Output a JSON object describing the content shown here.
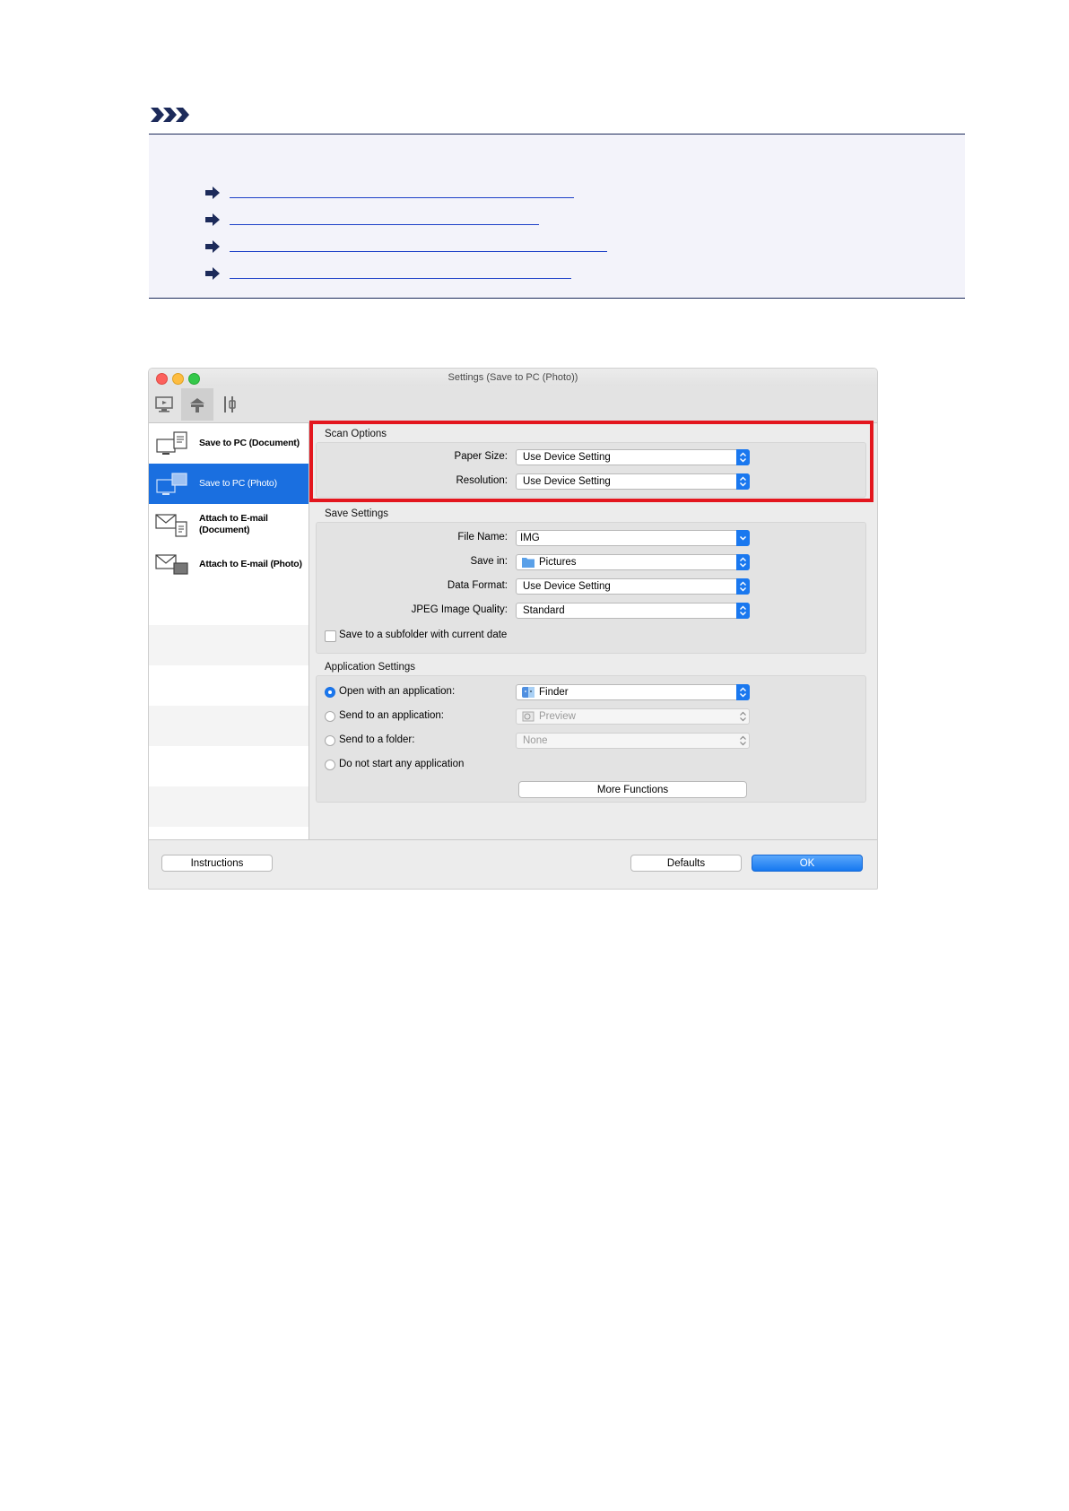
{
  "note": {
    "icon": "note-arrows-icon",
    "links": [
      {
        "id": "link-1",
        "text": ""
      },
      {
        "id": "link-2",
        "text": ""
      },
      {
        "id": "link-3",
        "text": ""
      },
      {
        "id": "link-4",
        "text": ""
      }
    ],
    "link_color": "#1c3fc7"
  },
  "window": {
    "title": "Settings (Save to PC (Photo))",
    "toolbar": [
      "scan-from-computer-icon",
      "scan-from-operation-panel-icon",
      "general-settings-icon"
    ],
    "sidebar": [
      {
        "label": "Save to PC (Document)",
        "selected": false
      },
      {
        "label": "Save to PC (Photo)",
        "selected": true
      },
      {
        "label": "Attach to E-mail (Document)",
        "selected": false
      },
      {
        "label": "Attach to E-mail (Photo)",
        "selected": false
      }
    ],
    "scan_options": {
      "title": "Scan Options",
      "paper_size_label": "Paper Size:",
      "paper_size_value": "Use Device Setting",
      "resolution_label": "Resolution:",
      "resolution_value": "Use Device Setting"
    },
    "save_settings": {
      "title": "Save Settings",
      "file_name_label": "File Name:",
      "file_name_value": "IMG",
      "save_in_label": "Save in:",
      "save_in_value": "Pictures",
      "data_format_label": "Data Format:",
      "data_format_value": "Use Device Setting",
      "jpeg_label": "JPEG Image Quality:",
      "jpeg_value": "Standard",
      "subfolder_label": "Save to a subfolder with current date"
    },
    "app_settings": {
      "title": "Application Settings",
      "open_app_label": "Open with an application:",
      "open_app_value": "Finder",
      "send_app_label": "Send to an application:",
      "send_app_value": "Preview",
      "send_folder_label": "Send to a folder:",
      "send_folder_value": "None",
      "no_app_label": "Do not start any application",
      "more_functions": "More Functions"
    },
    "buttons": {
      "instructions": "Instructions",
      "defaults": "Defaults",
      "ok": "OK"
    },
    "accent_color": "#1a78ef",
    "highlight_color": "#e3161e"
  }
}
